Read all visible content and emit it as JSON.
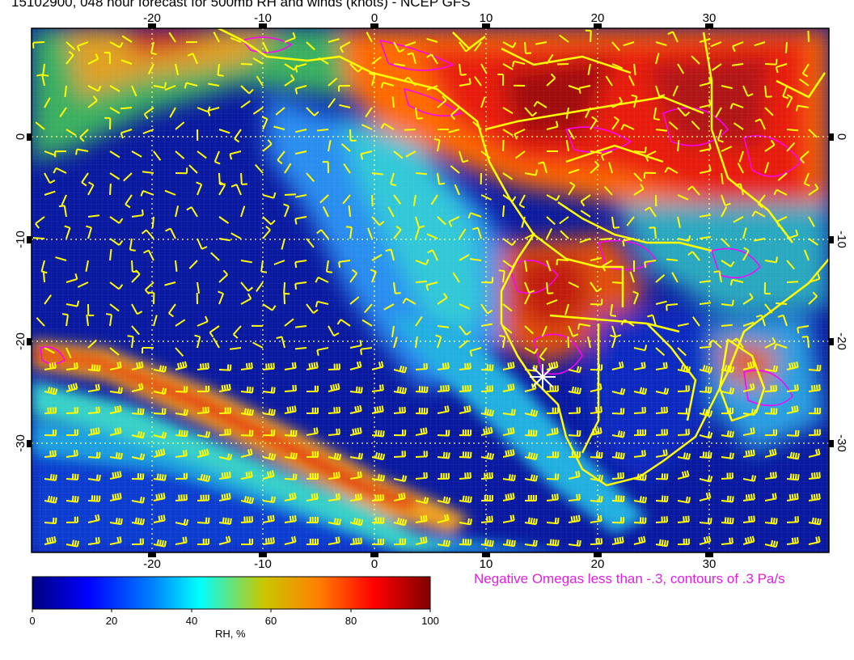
{
  "title": "15102900, 048 hour forecast for 500mb RH and winds (knots) - NCEP GFS",
  "omega_note": "Negative Omegas less than -.3, contours of .3 Pa/s",
  "colorbar": {
    "label": "RH, %",
    "ticks": [
      "0",
      "20",
      "40",
      "60",
      "80",
      "100"
    ],
    "colors": [
      "#00007f",
      "#0000ff",
      "#007fff",
      "#00ffff",
      "#c8c800",
      "#ff7f00",
      "#ff0000",
      "#7f0000"
    ]
  },
  "map": {
    "lon_range": [
      -30,
      41
    ],
    "lat_range": [
      -40,
      11
    ],
    "x_ticks": [
      "-20",
      "-10",
      "0",
      "10",
      "20",
      "30"
    ],
    "y_ticks": [
      "0",
      "-10",
      "-20",
      "-30"
    ],
    "grid": "dotted",
    "coastline_color": "#ffff00",
    "wind_barb_color": "#ffff00",
    "omega_contour_color": "#ff00ff",
    "marker": "white-star"
  }
}
